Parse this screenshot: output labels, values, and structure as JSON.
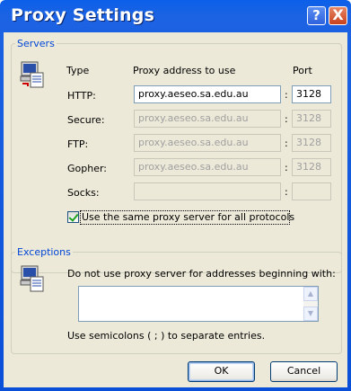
{
  "window": {
    "title": "Proxy Settings",
    "help_glyph": "?",
    "close_glyph": "X"
  },
  "servers": {
    "group_label": "Servers",
    "col_type": "Type",
    "col_address": "Proxy address to use",
    "col_port": "Port",
    "rows": [
      {
        "type": "HTTP:",
        "address": "proxy.aeseo.sa.edu.au",
        "port": "3128",
        "enabled": true
      },
      {
        "type": "Secure:",
        "address": "proxy.aeseo.sa.edu.au",
        "port": "3128",
        "enabled": false
      },
      {
        "type": "FTP:",
        "address": "proxy.aeseo.sa.edu.au",
        "port": "3128",
        "enabled": false
      },
      {
        "type": "Gopher:",
        "address": "proxy.aeseo.sa.edu.au",
        "port": "3128",
        "enabled": false
      },
      {
        "type": "Socks:",
        "address": "",
        "port": "",
        "enabled": false
      }
    ],
    "same_proxy_label": "Use the same proxy server for all protocols",
    "same_proxy_checked": true
  },
  "exceptions": {
    "group_label": "Exceptions",
    "description": "Do not use proxy server for addresses beginning with:",
    "value": "",
    "hint": "Use semicolons ( ; ) to separate entries."
  },
  "buttons": {
    "ok": "OK",
    "cancel": "Cancel"
  },
  "icons": {
    "servers": "computer-network-icon",
    "exceptions": "computer-list-icon"
  }
}
